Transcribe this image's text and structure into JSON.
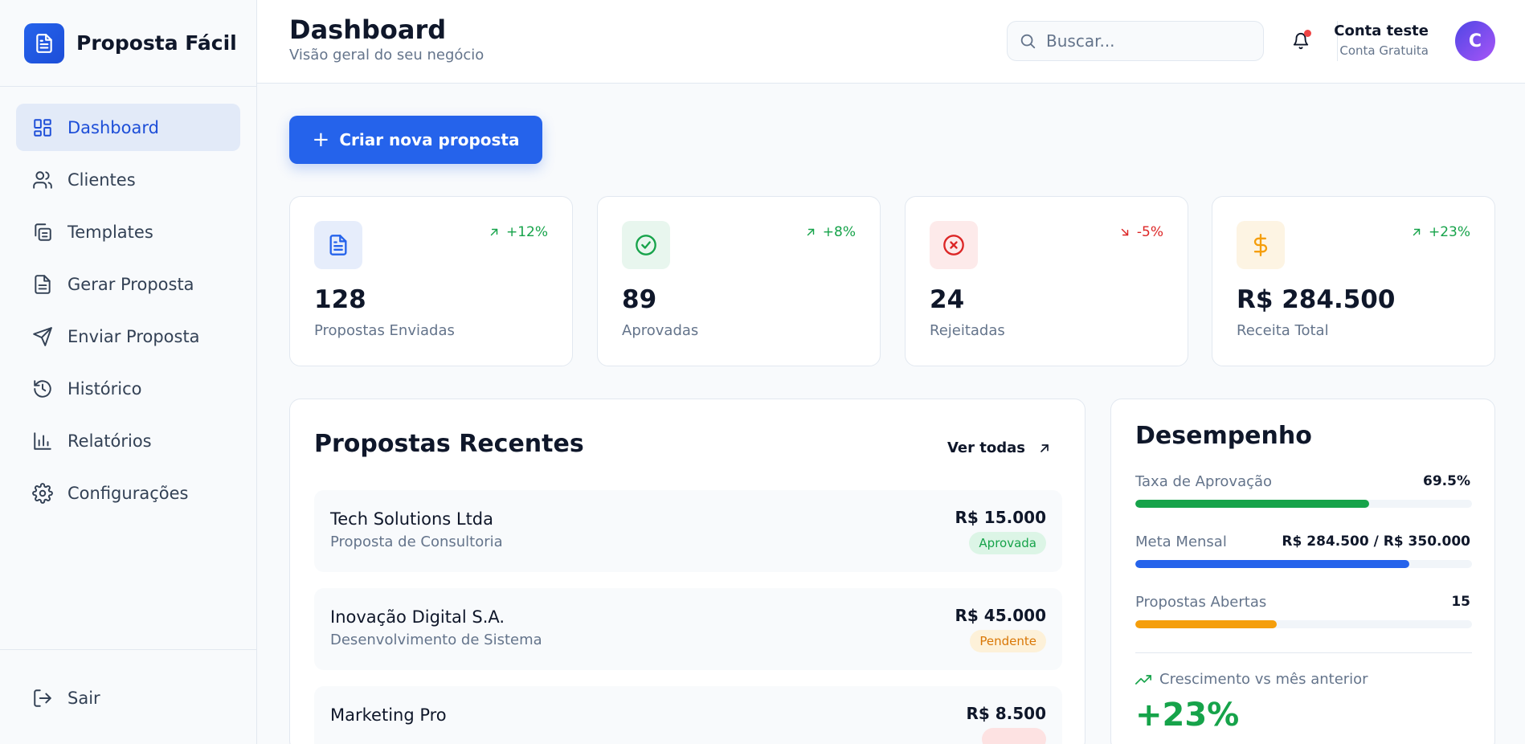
{
  "app": {
    "name": "Proposta Fácil",
    "logo_icon": "document-icon",
    "brand_color": "#2563eb"
  },
  "sidebar": {
    "items": [
      {
        "label": "Dashboard",
        "icon": "grid-icon",
        "active": true
      },
      {
        "label": "Clientes",
        "icon": "users-icon",
        "active": false
      },
      {
        "label": "Templates",
        "icon": "copy-icon",
        "active": false
      },
      {
        "label": "Gerar Proposta",
        "icon": "document-icon",
        "active": false
      },
      {
        "label": "Enviar Proposta",
        "icon": "send-icon",
        "active": false
      },
      {
        "label": "Histórico",
        "icon": "history-icon",
        "active": false
      },
      {
        "label": "Relatórios",
        "icon": "bar-chart-icon",
        "active": false
      },
      {
        "label": "Configurações",
        "icon": "gear-icon",
        "active": false
      }
    ],
    "logout": {
      "label": "Sair",
      "icon": "logout-icon"
    }
  },
  "header": {
    "title": "Dashboard",
    "subtitle": "Visão geral do seu negócio",
    "search_placeholder": "Buscar...",
    "user": {
      "name": "Conta teste",
      "plan": "Conta Gratuita",
      "initial": "C"
    }
  },
  "actions": {
    "create_label": "Criar nova proposta"
  },
  "stats": [
    {
      "value": "128",
      "label": "Propostas Enviadas",
      "trend": "+12%",
      "direction": "up",
      "icon": "document-icon",
      "color": "#2563eb",
      "bg": "#e6edfb"
    },
    {
      "value": "89",
      "label": "Aprovadas",
      "trend": "+8%",
      "direction": "up",
      "icon": "check-circle-icon",
      "color": "#16a34a",
      "bg": "#e8f6ee"
    },
    {
      "value": "24",
      "label": "Rejeitadas",
      "trend": "-5%",
      "direction": "down",
      "icon": "x-circle-icon",
      "color": "#dc2626",
      "bg": "#fdeaea"
    },
    {
      "value": "R$ 284.500",
      "label": "Receita Total",
      "trend": "+23%",
      "direction": "up",
      "icon": "dollar-icon",
      "color": "#f59e0b",
      "bg": "#fdf4e3"
    }
  ],
  "recent": {
    "title": "Propostas Recentes",
    "view_all": "Ver todas",
    "items": [
      {
        "client": "Tech Solutions Ltda",
        "description": "Proposta de Consultoria",
        "value": "R$ 15.000",
        "status": "Aprovada",
        "status_color": "#16a34a",
        "status_bg": "#dcf5e6"
      },
      {
        "client": "Inovação Digital S.A.",
        "description": "Desenvolvimento de Sistema",
        "value": "R$ 45.000",
        "status": "Pendente",
        "status_color": "#d97706",
        "status_bg": "#fdf1d9"
      },
      {
        "client": "Marketing Pro",
        "description": "",
        "value": "R$ 8.500",
        "status": "",
        "status_color": "#dc2626",
        "status_bg": "#fde2e2"
      }
    ]
  },
  "performance": {
    "title": "Desempenho",
    "metrics": [
      {
        "label": "Taxa de Aprovação",
        "value": "69.5%",
        "fraction": 0.695,
        "color": "#16a34a"
      },
      {
        "label": "Meta Mensal",
        "value": "R$ 284.500 / R$ 350.000",
        "fraction": 0.813,
        "color": "#2563eb"
      },
      {
        "label": "Propostas Abertas",
        "value": "15",
        "fraction": 0.42,
        "color": "#f59e0b"
      }
    ],
    "growth_label": "Crescimento vs mês anterior",
    "growth_value": "+23%"
  }
}
